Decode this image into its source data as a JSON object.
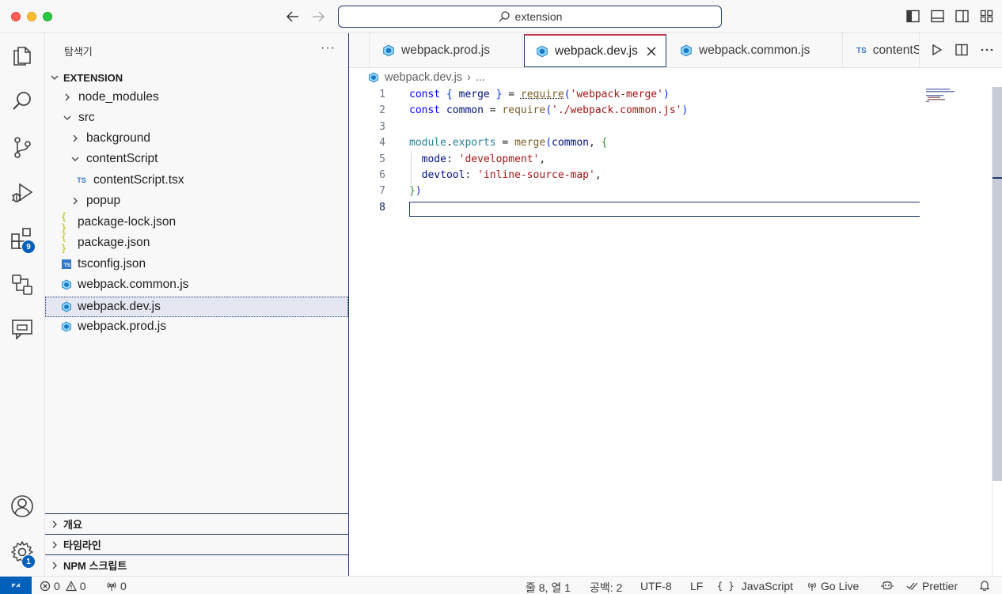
{
  "titlebar": {
    "search_text": "extension",
    "icons": [
      "arrow-left-icon",
      "arrow-right-icon",
      "search-icon",
      "toggle-sidebar-icon",
      "toggle-panel-icon",
      "toggle-secondary-sidebar-icon",
      "customize-layout-icon"
    ]
  },
  "activitybar": {
    "extensions_badge": "9",
    "settings_badge": "1",
    "icons": [
      "explorer-icon",
      "search-icon",
      "source-control-icon",
      "run-debug-icon",
      "extensions-icon",
      "remote-explorer-icon",
      "chat-icon",
      "account-icon",
      "gear-icon"
    ]
  },
  "sidebar": {
    "title": "탐색기",
    "more": "···",
    "root": "EXTENSION",
    "tree": [
      {
        "label": "node_modules",
        "type": "folder",
        "expanded": false
      },
      {
        "label": "src",
        "type": "folder",
        "expanded": true
      },
      {
        "label": "background",
        "type": "folder",
        "expanded": false
      },
      {
        "label": "contentScript",
        "type": "folder",
        "expanded": true
      },
      {
        "label": "contentScript.tsx",
        "type": "tsx"
      },
      {
        "label": "popup",
        "type": "folder",
        "expanded": false
      },
      {
        "label": "package-lock.json",
        "type": "json"
      },
      {
        "label": "package.json",
        "type": "json"
      },
      {
        "label": "tsconfig.json",
        "type": "tsconfig"
      },
      {
        "label": "webpack.common.js",
        "type": "webpack"
      },
      {
        "label": "webpack.dev.js",
        "type": "webpack",
        "selected": true
      },
      {
        "label": "webpack.prod.js",
        "type": "webpack"
      }
    ],
    "ts_label": "TS",
    "json_label": "{ }",
    "sections": [
      "개요",
      "타임라인",
      "NPM 스크립트"
    ]
  },
  "tabs": [
    {
      "label": "webpack.prod.js",
      "icon": "webpack-icon"
    },
    {
      "label": "webpack.dev.js",
      "icon": "webpack-icon",
      "active": true
    },
    {
      "label": "webpack.common.js",
      "icon": "webpack-icon"
    },
    {
      "label": "contentS",
      "icon": "ts-icon",
      "ts": "TS"
    }
  ],
  "breadcrumb": {
    "file": "webpack.dev.js",
    "sep": "›",
    "more": "..."
  },
  "editor": {
    "lines": [
      "1",
      "2",
      "3",
      "4",
      "5",
      "6",
      "7",
      "8"
    ],
    "code": {
      "l1": {
        "kw": "const",
        "b1": " { ",
        "v": "merge",
        "b2": " } ",
        "eq": "= ",
        "fn": "require",
        "p1": "(",
        "s": "'webpack-merge'",
        "p2": ")"
      },
      "l2": {
        "kw": "const",
        "v": " common ",
        "eq": "= ",
        "fn": "require",
        "p1": "(",
        "s": "'./webpack.common.js'",
        "p2": ")"
      },
      "l4": {
        "obj": "module",
        "dot": ".",
        "v": "exports",
        "eq": " = ",
        "fn": "merge",
        "p1": "(",
        "v2": "common",
        "c": ", ",
        "b": "{"
      },
      "l5": {
        "v": "  mode",
        "c": ": ",
        "s": "'development'",
        "t": ","
      },
      "l6": {
        "v": "  devtool",
        "c": ": ",
        "s": "'inline-source-map'",
        "t": ","
      },
      "l7": {
        "b": "}",
        "p": ")"
      }
    }
  },
  "statusbar": {
    "errors": "0",
    "warnings": "0",
    "ports": "0",
    "position": "줄 8, 열 1",
    "spaces": "공백: 2",
    "encoding": "UTF-8",
    "eol": "LF",
    "lang_braces": "{ }",
    "language": "JavaScript",
    "golive": "Go Live",
    "prettier": "Prettier"
  }
}
